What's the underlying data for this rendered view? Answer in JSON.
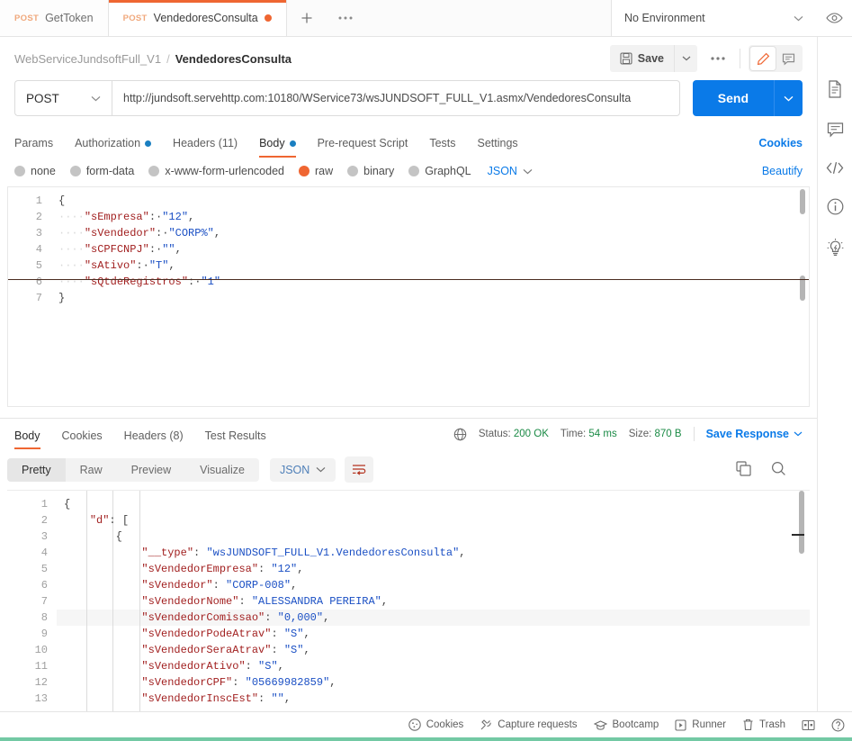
{
  "tabs": [
    {
      "method": "POST",
      "name": "GetToken",
      "unsaved": false,
      "active": false
    },
    {
      "method": "POST",
      "name": "VendedoresConsulta",
      "unsaved": true,
      "active": true
    }
  ],
  "tabbar": {
    "plus_label": "+",
    "more_label": "•••",
    "environment": "No Environment",
    "eye_icon": "eye-icon",
    "caret_icon": "chevron-down-icon"
  },
  "breadcrumb": {
    "collection": "WebServiceJundsoftFull_V1",
    "separator": "/",
    "request": "VendedoresConsulta",
    "save_label": "Save",
    "save_icon": "floppy-disk-icon",
    "more_label": "•••",
    "edit_icon": "pencil-icon",
    "comment_icon": "comment-icon"
  },
  "url_bar": {
    "method": "POST",
    "url": "http://jundsoft.servehttp.com:10180/WService73/wsJUNDSOFT_FULL_V1.asmx/VendedoresConsulta",
    "send_label": "Send"
  },
  "request_tabs": [
    {
      "label": "Params",
      "dot": false,
      "active": false
    },
    {
      "label": "Authorization",
      "dot": true,
      "active": false
    },
    {
      "label": "Headers (11)",
      "dot": false,
      "active": false
    },
    {
      "label": "Body",
      "dot": true,
      "active": true
    },
    {
      "label": "Pre-request Script",
      "dot": false,
      "active": false
    },
    {
      "label": "Tests",
      "dot": false,
      "active": false
    },
    {
      "label": "Settings",
      "dot": false,
      "active": false
    }
  ],
  "request_tabs_right": {
    "cookies_label": "Cookies",
    "code_icon": "code-icon"
  },
  "body_types": [
    {
      "label": "none",
      "selected": false
    },
    {
      "label": "form-data",
      "selected": false
    },
    {
      "label": "x-www-form-urlencoded",
      "selected": false
    },
    {
      "label": "raw",
      "selected": true
    },
    {
      "label": "binary",
      "selected": false
    },
    {
      "label": "GraphQL",
      "selected": false
    }
  ],
  "body_format": {
    "label": "JSON",
    "caret_icon": "chevron-down-icon"
  },
  "beautify_label": "Beautify",
  "request_body": {
    "language": "json",
    "lines": [
      {
        "n": 1,
        "tokens": [
          {
            "t": "{",
            "c": "p"
          }
        ]
      },
      {
        "n": 2,
        "tokens": [
          {
            "t": "····",
            "c": "inv"
          },
          {
            "t": "\"sEmpresa\"",
            "c": "k"
          },
          {
            "t": ":·",
            "c": "p"
          },
          {
            "t": "\"12\"",
            "c": "s"
          },
          {
            "t": ",",
            "c": "p"
          }
        ]
      },
      {
        "n": 3,
        "tokens": [
          {
            "t": "····",
            "c": "inv"
          },
          {
            "t": "\"sVendedor\"",
            "c": "k"
          },
          {
            "t": ":·",
            "c": "p"
          },
          {
            "t": "\"CORP%\"",
            "c": "s"
          },
          {
            "t": ",",
            "c": "p"
          }
        ]
      },
      {
        "n": 4,
        "tokens": [
          {
            "t": "····",
            "c": "inv"
          },
          {
            "t": "\"sCPFCNPJ\"",
            "c": "k"
          },
          {
            "t": ":·",
            "c": "p"
          },
          {
            "t": "\"\"",
            "c": "s"
          },
          {
            "t": ",",
            "c": "p"
          }
        ]
      },
      {
        "n": 5,
        "tokens": [
          {
            "t": "····",
            "c": "inv"
          },
          {
            "t": "\"sAtivo\"",
            "c": "k"
          },
          {
            "t": ":·",
            "c": "p"
          },
          {
            "t": "\"T\"",
            "c": "s"
          },
          {
            "t": ",",
            "c": "p"
          }
        ]
      },
      {
        "n": 6,
        "tokens": [
          {
            "t": "····",
            "c": "inv"
          },
          {
            "t": "\"sQtdeRegistros\"",
            "c": "k"
          },
          {
            "t": ":·",
            "c": "p"
          },
          {
            "t": "\"1\"",
            "c": "s"
          }
        ]
      },
      {
        "n": 7,
        "tokens": [
          {
            "t": "}",
            "c": "p"
          }
        ]
      }
    ]
  },
  "response_tabs": [
    {
      "label": "Body",
      "active": true
    },
    {
      "label": "Cookies",
      "active": false
    },
    {
      "label": "Headers (8)",
      "active": false
    },
    {
      "label": "Test Results",
      "active": false
    }
  ],
  "response_meta": {
    "globe_icon": "globe-icon",
    "status_label": "Status:",
    "status_value": "200 OK",
    "time_label": "Time:",
    "time_value": "54 ms",
    "size_label": "Size:",
    "size_value": "870 B",
    "save_response_label": "Save Response"
  },
  "response_views": [
    {
      "label": "Pretty",
      "active": true
    },
    {
      "label": "Raw",
      "active": false
    },
    {
      "label": "Preview",
      "active": false
    },
    {
      "label": "Visualize",
      "active": false
    }
  ],
  "response_format": {
    "label": "JSON",
    "caret_icon": "chevron-down-icon"
  },
  "response_toolbar": {
    "wrap_icon": "word-wrap-icon",
    "copy_icon": "copy-icon",
    "search_icon": "search-icon"
  },
  "response_body": {
    "language": "json",
    "highlighted_line": 8,
    "lines": [
      {
        "n": 1,
        "tokens": [
          {
            "t": "{",
            "c": "p"
          }
        ]
      },
      {
        "n": 2,
        "tokens": [
          {
            "t": "    ",
            "c": "p"
          },
          {
            "t": "\"d\"",
            "c": "k"
          },
          {
            "t": ": [",
            "c": "p"
          }
        ]
      },
      {
        "n": 3,
        "tokens": [
          {
            "t": "        ",
            "c": "p"
          },
          {
            "t": "{",
            "c": "p"
          }
        ]
      },
      {
        "n": 4,
        "tokens": [
          {
            "t": "            ",
            "c": "p"
          },
          {
            "t": "\"__type\"",
            "c": "k"
          },
          {
            "t": ": ",
            "c": "p"
          },
          {
            "t": "\"wsJUNDSOFT_FULL_V1.VendedoresConsulta\"",
            "c": "s"
          },
          {
            "t": ",",
            "c": "p"
          }
        ]
      },
      {
        "n": 5,
        "tokens": [
          {
            "t": "            ",
            "c": "p"
          },
          {
            "t": "\"sVendedorEmpresa\"",
            "c": "k"
          },
          {
            "t": ": ",
            "c": "p"
          },
          {
            "t": "\"12\"",
            "c": "s"
          },
          {
            "t": ",",
            "c": "p"
          }
        ]
      },
      {
        "n": 6,
        "tokens": [
          {
            "t": "            ",
            "c": "p"
          },
          {
            "t": "\"sVendedor\"",
            "c": "k"
          },
          {
            "t": ": ",
            "c": "p"
          },
          {
            "t": "\"CORP-008\"",
            "c": "s"
          },
          {
            "t": ",",
            "c": "p"
          }
        ]
      },
      {
        "n": 7,
        "tokens": [
          {
            "t": "            ",
            "c": "p"
          },
          {
            "t": "\"sVendedorNome\"",
            "c": "k"
          },
          {
            "t": ": ",
            "c": "p"
          },
          {
            "t": "\"ALESSANDRA PEREIRA\"",
            "c": "s"
          },
          {
            "t": ",",
            "c": "p"
          }
        ]
      },
      {
        "n": 8,
        "tokens": [
          {
            "t": "            ",
            "c": "p"
          },
          {
            "t": "\"sVendedorComissao\"",
            "c": "k"
          },
          {
            "t": ": ",
            "c": "p"
          },
          {
            "t": "\"0,000\"",
            "c": "s"
          },
          {
            "t": ",",
            "c": "p"
          }
        ]
      },
      {
        "n": 9,
        "tokens": [
          {
            "t": "            ",
            "c": "p"
          },
          {
            "t": "\"sVendedorPodeAtrav\"",
            "c": "k"
          },
          {
            "t": ": ",
            "c": "p"
          },
          {
            "t": "\"S\"",
            "c": "s"
          },
          {
            "t": ",",
            "c": "p"
          }
        ]
      },
      {
        "n": 10,
        "tokens": [
          {
            "t": "            ",
            "c": "p"
          },
          {
            "t": "\"sVendedorSeraAtrav\"",
            "c": "k"
          },
          {
            "t": ": ",
            "c": "p"
          },
          {
            "t": "\"S\"",
            "c": "s"
          },
          {
            "t": ",",
            "c": "p"
          }
        ]
      },
      {
        "n": 11,
        "tokens": [
          {
            "t": "            ",
            "c": "p"
          },
          {
            "t": "\"sVendedorAtivo\"",
            "c": "k"
          },
          {
            "t": ": ",
            "c": "p"
          },
          {
            "t": "\"S\"",
            "c": "s"
          },
          {
            "t": ",",
            "c": "p"
          }
        ]
      },
      {
        "n": 12,
        "tokens": [
          {
            "t": "            ",
            "c": "p"
          },
          {
            "t": "\"sVendedorCPF\"",
            "c": "k"
          },
          {
            "t": ": ",
            "c": "p"
          },
          {
            "t": "\"05669982859\"",
            "c": "s"
          },
          {
            "t": ",",
            "c": "p"
          }
        ]
      },
      {
        "n": 13,
        "tokens": [
          {
            "t": "            ",
            "c": "p"
          },
          {
            "t": "\"sVendedorInscEst\"",
            "c": "k"
          },
          {
            "t": ": ",
            "c": "p"
          },
          {
            "t": "\"\"",
            "c": "s"
          },
          {
            "t": ",",
            "c": "p"
          }
        ]
      }
    ]
  },
  "rail_icons": [
    "document-icon",
    "comment-icon",
    "code-icon",
    "info-icon",
    "lightbulb-icon"
  ],
  "bottom_bar": {
    "items": [
      {
        "label": "Cookies",
        "icon": "cookie-icon"
      },
      {
        "label": "Capture requests",
        "icon": "satellite-icon"
      },
      {
        "label": "Bootcamp",
        "icon": "graduation-cap-icon"
      },
      {
        "label": "Runner",
        "icon": "play-box-icon"
      },
      {
        "label": "Trash",
        "icon": "trash-icon"
      }
    ],
    "layout_icon": "panel-layout-icon",
    "help_icon": "help-icon"
  },
  "colors": {
    "accent_orange": "#ef6632",
    "link_blue": "#0a7ae8",
    "send_blue": "#0a7ae8",
    "status_green": "#1a8a45",
    "bottom_accent": "#73c9a4"
  }
}
